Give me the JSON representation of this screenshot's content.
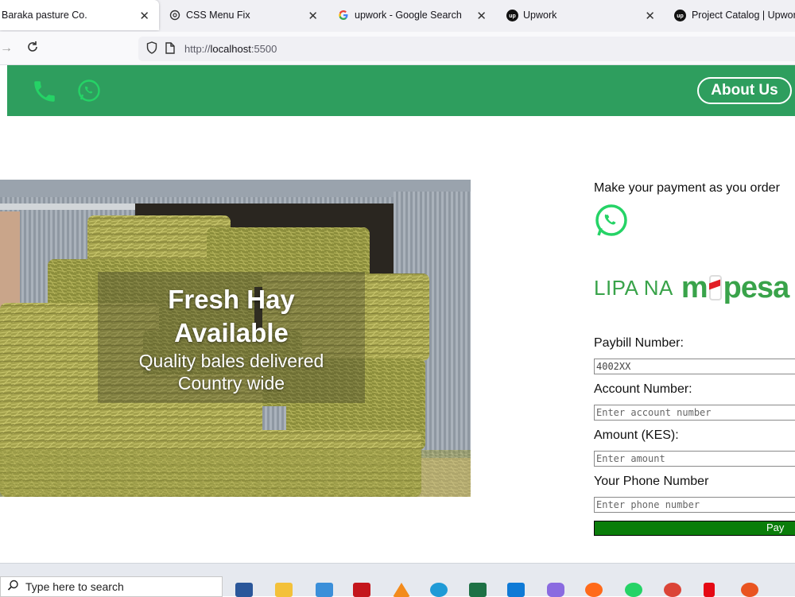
{
  "browser": {
    "tabs": [
      {
        "title": "Baraka pasture Co.",
        "active": true
      },
      {
        "title": "CSS Menu Fix"
      },
      {
        "title": "upwork - Google Search"
      },
      {
        "title": "Upwork"
      },
      {
        "title": "Project Catalog | Upwork"
      }
    ],
    "url_prefix": "http://",
    "url_host": "localhost",
    "url_port": ":5500"
  },
  "header": {
    "about_label": "About Us",
    "icon_color": "#25d366",
    "bg_color": "#2e9e5e"
  },
  "hero": {
    "title_line1": "Fresh Hay",
    "title_line2": "Available",
    "subtitle_line1": "Quality bales delivered",
    "subtitle_line2": "Country wide"
  },
  "payment": {
    "heading": "Make your payment as you order",
    "logo_text_left": "LIPA NA",
    "logo_text_m": "m",
    "logo_text_right": "pesa",
    "paybill_label": "Paybill Number:",
    "paybill_value": "4002XX",
    "account_label": "Account Number:",
    "account_placeholder": "Enter account number",
    "amount_label": "Amount (KES):",
    "amount_placeholder": "Enter amount",
    "phone_label": "Your Phone Number",
    "phone_placeholder": "Enter phone number",
    "pay_label": "Pay No",
    "brand_green": "#0a7d0a"
  },
  "taskbar": {
    "search_placeholder": "Type here to search"
  }
}
